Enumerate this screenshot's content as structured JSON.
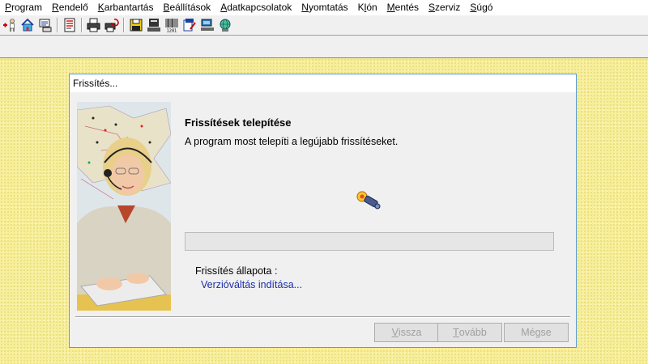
{
  "menubar": {
    "items": [
      {
        "label": "Program",
        "key": "P",
        "rest": "rogram"
      },
      {
        "label": "Rendelő",
        "key": "R",
        "rest": "endelő"
      },
      {
        "label": "Karbantartás",
        "key": "K",
        "rest": "arbantartás"
      },
      {
        "label": "Beállítások",
        "key": "B",
        "rest": "eállítások"
      },
      {
        "label": "Adatkapcsolatok",
        "key": "A",
        "rest": "datkapcsolatok"
      },
      {
        "label": "Nyomtatás",
        "key": "N",
        "rest": "yomtatás"
      },
      {
        "label": "Klón",
        "pre": "K",
        "key": "l",
        "rest": "ón"
      },
      {
        "label": "Mentés",
        "key": "M",
        "rest": "entés"
      },
      {
        "label": "Szerviz",
        "key": "S",
        "rest": "zerviz"
      },
      {
        "label": "Súgó",
        "key": "S",
        "rest": "úgó"
      }
    ]
  },
  "toolbar": {
    "buttons": [
      "user-add-icon",
      "home-icon",
      "monitor-list-icon",
      "document-icon",
      "print-icon",
      "print-refresh-icon",
      "save-disk-icon",
      "server-icon",
      "barcode-icon",
      "edit-document-icon",
      "network-icon",
      "globe-icon"
    ],
    "barcode_text": "1281"
  },
  "dialog": {
    "title": "Frissítés...",
    "heading": "Frissítések telepítése",
    "subtext": "A program most telepíti a legújabb frissítéseket.",
    "status_label": "Frissítés állapota :",
    "status_value": "Verzióváltás indítása...",
    "progress": 0,
    "buttons": {
      "back": {
        "pre": "",
        "key": "V",
        "rest": "issza"
      },
      "next": {
        "pre": "",
        "key": "T",
        "rest": "ovább"
      },
      "cancel": {
        "pre": "",
        "key": "",
        "rest": "Mégse"
      }
    }
  },
  "colors": {
    "workspace": "#f6ee9a",
    "dialog_border": "#5a9bd5",
    "status_value": "#1c2fa8"
  }
}
